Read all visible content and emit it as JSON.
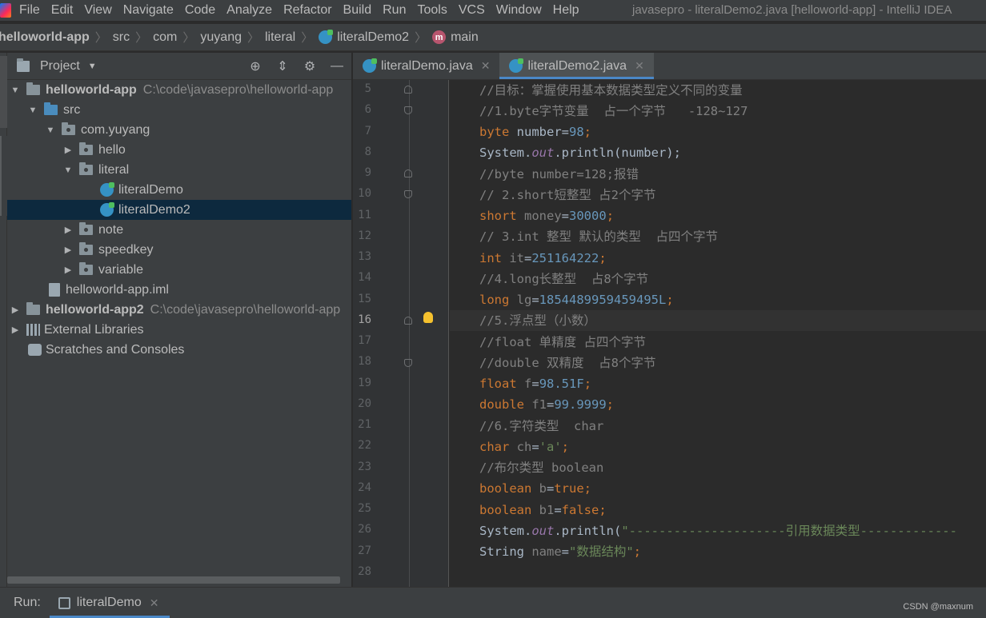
{
  "menubar": {
    "items": [
      "File",
      "Edit",
      "View",
      "Navigate",
      "Code",
      "Analyze",
      "Refactor",
      "Build",
      "Run",
      "Tools",
      "VCS",
      "Window",
      "Help"
    ],
    "title": "javasepro - literalDemo2.java [helloworld-app] - IntelliJ IDEA"
  },
  "breadcrumb": {
    "project": "helloworld-app",
    "items": [
      "src",
      "com",
      "yuyang",
      "literal"
    ],
    "file": "literalDemo2",
    "method": "main"
  },
  "project_panel": {
    "title": "Project",
    "tree": [
      {
        "label": "helloworld-app",
        "path": "C:\\code\\javasepro\\helloworld-app"
      },
      {
        "label": "src"
      },
      {
        "label": "com.yuyang"
      },
      {
        "label": "hello"
      },
      {
        "label": "literal"
      },
      {
        "label": "literalDemo"
      },
      {
        "label": "literalDemo2"
      },
      {
        "label": "note"
      },
      {
        "label": "speedkey"
      },
      {
        "label": "variable"
      },
      {
        "label": "helloworld-app.iml"
      },
      {
        "label": "helloworld-app2",
        "path": "C:\\code\\javasepro\\helloworld-app"
      },
      {
        "label": "External Libraries"
      },
      {
        "label": "Scratches and Consoles"
      }
    ]
  },
  "editor": {
    "tabs": [
      {
        "label": "literalDemo.java"
      },
      {
        "label": "literalDemo2.java"
      }
    ],
    "line_numbers": [
      "5",
      "6",
      "7",
      "8",
      "9",
      "10",
      "11",
      "12",
      "13",
      "14",
      "15",
      "16",
      "17",
      "18",
      "19",
      "20",
      "21",
      "22",
      "23",
      "24",
      "25",
      "26",
      "27",
      "28"
    ],
    "code": {
      "l5": "//目标：掌握使用基本数据类型定义不同的变量",
      "l6": "//1.byte字节变量  占一个字节   -128~127",
      "l7_kw": "byte",
      "l7_id": " number=",
      "l7_num": "98",
      "l7_end": ";",
      "l8_a": "System.",
      "l8_b": "out",
      "l8_c": ".println(number);",
      "l9": "//byte number=128;报错",
      "l10": "// 2.short短整型 占2个字节",
      "l11_kw": "short",
      "l11_id": " money",
      "l11_eq": "=",
      "l11_num": "30000",
      "l11_end": ";",
      "l12": "// 3.int 整型 默认的类型  占四个字节",
      "l13_kw": "int",
      "l13_id": " it",
      "l13_eq": "=",
      "l13_num": "251164222",
      "l13_end": ";",
      "l14": "//4.long长整型  占8个字节",
      "l15_kw": "long",
      "l15_id": " lg",
      "l15_eq": "=",
      "l15_num": "1854489959459495L",
      "l15_end": ";",
      "l16": "//5.浮点型（小数）",
      "l17": "//float 单精度 占四个字节",
      "l18": "//double 双精度  占8个字节",
      "l19_kw": "float",
      "l19_id": " f",
      "l19_eq": "=",
      "l19_num": "98.51F",
      "l19_end": ";",
      "l20_kw": "double",
      "l20_id": " f1",
      "l20_eq": "=",
      "l20_num": "99.9999",
      "l20_end": ";",
      "l21": "//6.字符类型  char",
      "l22_kw": "char",
      "l22_id": " ch",
      "l22_eq": "=",
      "l22_str": "'a'",
      "l22_end": ";",
      "l23": "//布尔类型 boolean",
      "l24_kw": "boolean",
      "l24_id": " b",
      "l24_eq": "=",
      "l24_val": "true",
      "l24_end": ";",
      "l25_kw": "boolean",
      "l25_id": " b1",
      "l25_eq": "=",
      "l25_val": "false",
      "l25_end": ";",
      "l26_a": "System.",
      "l26_b": "out",
      "l26_c": ".println(",
      "l26_str": "\"---------------------引用数据类型-------------",
      "l27_a": "String ",
      "l27_id": "name",
      "l27_eq": "=",
      "l27_str": "\"数据结构\"",
      "l27_end": ";"
    }
  },
  "run_bar": {
    "label": "Run:",
    "tab": "literalDemo",
    "watermark": "CSDN @maxnum"
  }
}
